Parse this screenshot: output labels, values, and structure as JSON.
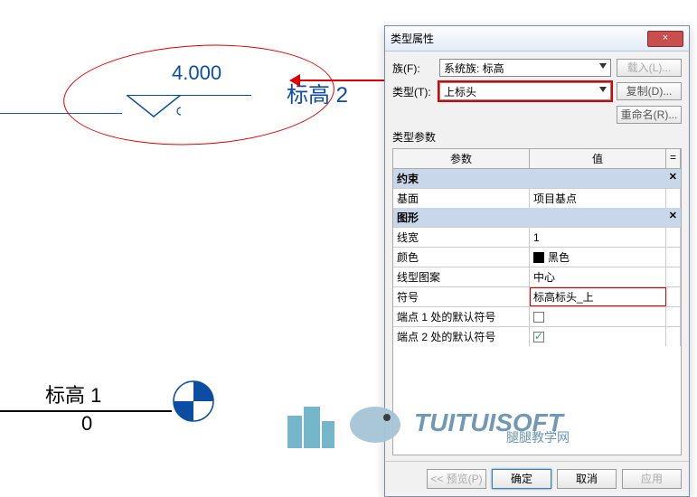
{
  "dialog": {
    "title": "类型属性",
    "close": "×",
    "family_label": "族(F):",
    "family_value": "系统族: 标高",
    "type_label": "类型(T):",
    "type_value": "上标头",
    "btn_load": "载入(L)...",
    "btn_copy": "复制(D)...",
    "btn_rename": "重命名(R)...",
    "section": "类型参数",
    "col_param": "参数",
    "col_value": "值",
    "col_eq": "=",
    "group_constraint": "约束",
    "row_base_param": "基面",
    "row_base_value": "项目基点",
    "group_graphics": "图形",
    "row_lw_param": "线宽",
    "row_lw_value": "1",
    "row_color_param": "颜色",
    "row_color_value": "黑色",
    "row_pattern_param": "线型图案",
    "row_pattern_value": "中心",
    "row_symbol_param": "符号",
    "row_symbol_value": "标高标头_上",
    "row_end1_param": "端点 1 处的默认符号",
    "row_end2_param": "端点 2 处的默认符号",
    "btn_preview": "<< 预览(P)",
    "btn_ok": "确定",
    "btn_cancel": "取消",
    "btn_apply": "应用"
  },
  "drawing": {
    "level2_value": "4.000",
    "level2_label": "标高 2",
    "level1_label": "标高 1",
    "level1_value": "0"
  },
  "watermark": {
    "brand": "TUITUISOFT",
    "sub": "腿腿教学网"
  }
}
